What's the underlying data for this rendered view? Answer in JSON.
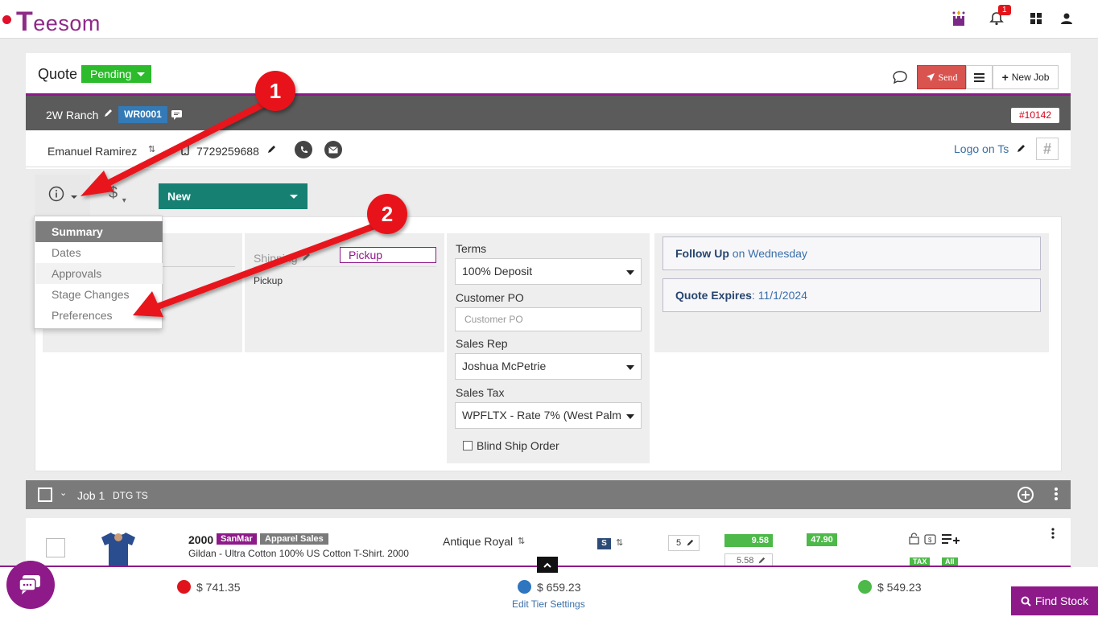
{
  "app": {
    "logo_initial": "T",
    "logo_rest": "eesom",
    "notification_count": "1"
  },
  "quote": {
    "title": "Quote",
    "status": "Pending",
    "order_number": "#10142"
  },
  "toolbar": {
    "send_label": "Send",
    "new_job_label": "New Job"
  },
  "customer": {
    "name": "2W Ranch",
    "code": "WR0001"
  },
  "contact": {
    "name": "Emanuel Ramirez",
    "phone": "7729259688",
    "logo_link": "Logo on Ts"
  },
  "tabs": {
    "stage_select": "New"
  },
  "info_menu": {
    "items": [
      {
        "label": "Summary"
      },
      {
        "label": "Dates"
      },
      {
        "label": "Approvals"
      },
      {
        "label": "Stage Changes"
      },
      {
        "label": "Preferences"
      }
    ]
  },
  "shipping": {
    "label": "Shipping",
    "method": "Pickup",
    "method_text": "Pickup"
  },
  "fields": {
    "terms_label": "Terms",
    "terms_value": "100% Deposit",
    "po_label": "Customer PO",
    "po_placeholder": "Customer PO",
    "rep_label": "Sales Rep",
    "rep_value": "Joshua McPetrie",
    "tax_label": "Sales Tax",
    "tax_value": "WPFLTX - Rate 7% (West Palm",
    "blind_ship_label": "Blind Ship Order"
  },
  "follow_up": {
    "label": "Follow Up",
    "value": "on Wednesday"
  },
  "expires": {
    "label": "Quote Expires",
    "value": ": 11/1/2024"
  },
  "job": {
    "label": "Job 1",
    "type": "DTG TS"
  },
  "line_item": {
    "style": "2000",
    "supplier": "SanMar",
    "category": "Apparel Sales",
    "description": "Gildan - Ultra Cotton 100% US Cotton T-Shirt. 2000",
    "color": "Antique Royal",
    "size": "S",
    "qty": "5",
    "price": "9.58",
    "sub_price": "5.58",
    "total": "47.90",
    "tax_tag": "TAX",
    "all_tag": "All"
  },
  "totals": {
    "t1": "$ 741.35",
    "t2": "$ 659.23",
    "t3": "$ 549.23",
    "edit_tier": "Edit Tier Settings"
  },
  "find_stock": "Find Stock",
  "annotations": {
    "n1": "1",
    "n2": "2"
  },
  "colors": {
    "brand": "#8e1a8a",
    "pending": "#2bbb2b",
    "stage": "#168073",
    "send": "#d9534f",
    "arrow": "#e8131a"
  }
}
